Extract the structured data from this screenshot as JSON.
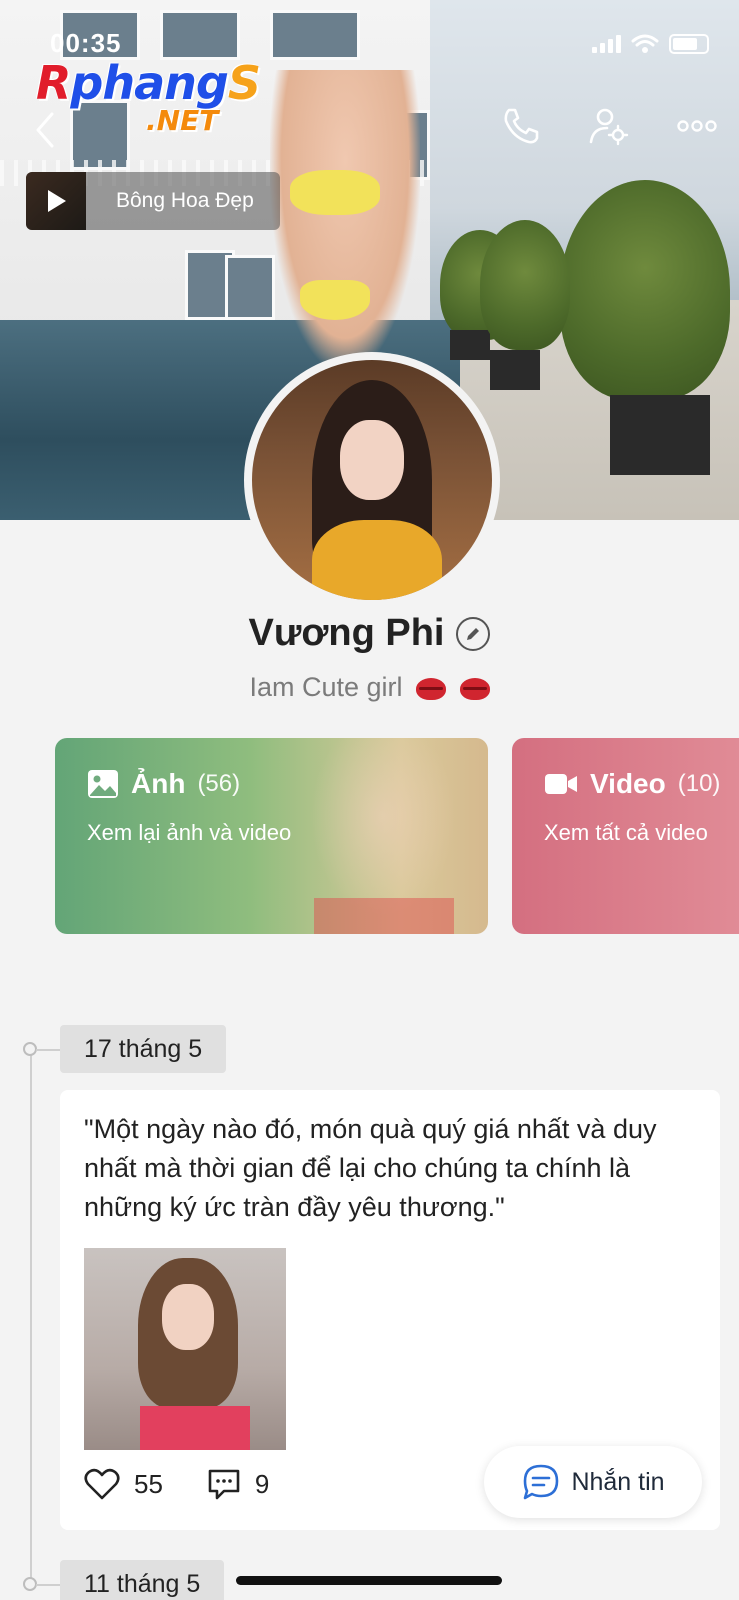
{
  "status_bar": {
    "time": "00:35"
  },
  "watermark": {
    "line1_r": "R",
    "line1_main": "phang",
    "line1_s": "S",
    "line2": ".NET"
  },
  "music": {
    "title": "Bông Hoa Đẹp"
  },
  "profile": {
    "name": "Vương Phi",
    "bio": "Iam Cute girl"
  },
  "media_cards": {
    "photos": {
      "label": "Ảnh",
      "count": "(56)",
      "subtitle": "Xem lại ảnh và video"
    },
    "videos": {
      "label": "Video",
      "count": "(10)",
      "subtitle": "Xem tất cả video"
    }
  },
  "timeline": {
    "entries": [
      {
        "date": "17 tháng 5",
        "text": "\"Một ngày nào đó, món quà quý giá nhất và duy nhất mà thời gian để lại cho chúng ta chính là những ký ức tràn đầy yêu thương.\"",
        "likes": "55",
        "comments": "9"
      },
      {
        "date": "11 tháng 5"
      }
    ]
  },
  "message_button": {
    "label": "Nhắn tin"
  },
  "colors": {
    "photo_card": "#63a577",
    "video_card": "#d46f80",
    "text_primary": "#222222",
    "text_secondary": "#7b7b7b",
    "background": "#f3f3f3"
  },
  "icons": [
    "back-icon",
    "phone-icon",
    "user-settings-icon",
    "more-icon",
    "play-icon",
    "edit-icon",
    "image-icon",
    "video-camera-icon",
    "heart-icon",
    "comment-icon",
    "chat-icon",
    "lips-emoji"
  ]
}
